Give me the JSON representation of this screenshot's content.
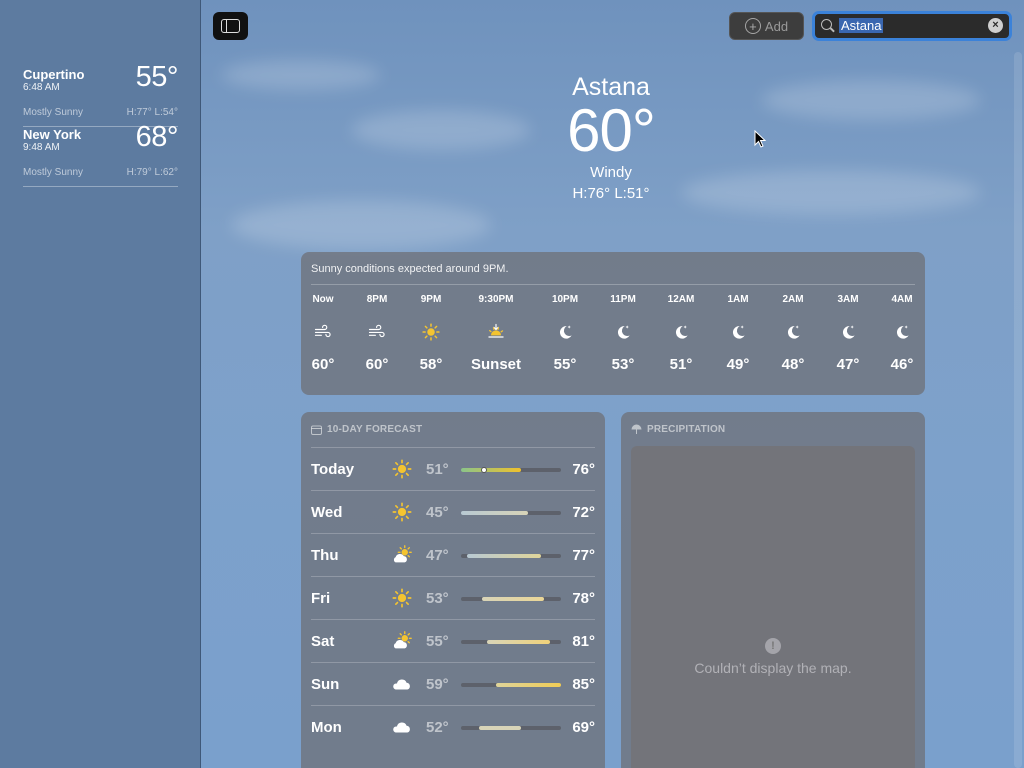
{
  "sidebar": {
    "cities": [
      {
        "name": "Cupertino",
        "time": "6:48 AM",
        "temp": "55°",
        "condition": "Mostly Sunny",
        "hilo": "H:77°  L:54°"
      },
      {
        "name": "New York",
        "time": "9:48 AM",
        "temp": "68°",
        "condition": "Mostly Sunny",
        "hilo": "H:79°  L:62°"
      }
    ]
  },
  "toolbar": {
    "add_label": "Add",
    "search_value": "Astana"
  },
  "current": {
    "city": "Astana",
    "temp": "60°",
    "condition": "Windy",
    "hilo": "H:76°  L:51°"
  },
  "hourly": {
    "summary": "Sunny conditions expected around 9PM.",
    "hours": [
      {
        "label": "Now",
        "icon": "wind-icon",
        "temp": "60°"
      },
      {
        "label": "8PM",
        "icon": "wind-icon",
        "temp": "60°"
      },
      {
        "label": "9PM",
        "icon": "sun-icon",
        "temp": "58°"
      },
      {
        "label": "9:30PM",
        "icon": "sunset-icon",
        "temp": "Sunset"
      },
      {
        "label": "10PM",
        "icon": "moon-stars-icon",
        "temp": "55°"
      },
      {
        "label": "11PM",
        "icon": "moon-stars-icon",
        "temp": "53°"
      },
      {
        "label": "12AM",
        "icon": "moon-stars-icon",
        "temp": "51°"
      },
      {
        "label": "1AM",
        "icon": "moon-stars-icon",
        "temp": "49°"
      },
      {
        "label": "2AM",
        "icon": "moon-stars-icon",
        "temp": "48°"
      },
      {
        "label": "3AM",
        "icon": "moon-stars-icon",
        "temp": "47°"
      },
      {
        "label": "4AM",
        "icon": "moon-stars-icon",
        "temp": "46°"
      }
    ]
  },
  "forecast": {
    "header": "10-DAY FORECAST",
    "days": [
      {
        "day": "Today",
        "icon": "sun-icon",
        "lo": "51°",
        "hi": "76°",
        "range_start": 0.0,
        "range_end": 0.6,
        "current_marker": 0.23,
        "colors": [
          "#8bc48a",
          "#f0c12c"
        ]
      },
      {
        "day": "Wed",
        "icon": "sun-icon",
        "lo": "45°",
        "hi": "72°",
        "range_start": 0.0,
        "range_end": 0.67,
        "colors": [
          "#b8c9d3",
          "#d8d4b8"
        ]
      },
      {
        "day": "Thu",
        "icon": "partly-cloudy-icon",
        "lo": "47°",
        "hi": "77°",
        "range_start": 0.06,
        "range_end": 0.8,
        "colors": [
          "#b8c9d3",
          "#e0d59a"
        ]
      },
      {
        "day": "Fri",
        "icon": "sun-icon",
        "lo": "53°",
        "hi": "78°",
        "range_start": 0.21,
        "range_end": 0.83,
        "colors": [
          "#d8d4b8",
          "#ead697"
        ]
      },
      {
        "day": "Sat",
        "icon": "partly-cloudy-icon",
        "lo": "55°",
        "hi": "81°",
        "range_start": 0.26,
        "range_end": 0.89,
        "colors": [
          "#d8d4b8",
          "#f0d27a"
        ]
      },
      {
        "day": "Sun",
        "icon": "cloud-icon",
        "lo": "59°",
        "hi": "85°",
        "range_start": 0.35,
        "range_end": 1.0,
        "colors": [
          "#dfd49a",
          "#f0cc55"
        ]
      },
      {
        "day": "Mon",
        "icon": "cloud-icon",
        "lo": "52°",
        "hi": "69°",
        "range_start": 0.18,
        "range_end": 0.6,
        "colors": [
          "#d8d4b8",
          "#d8d4b8"
        ]
      }
    ]
  },
  "precipitation": {
    "header": "PRECIPITATION",
    "message": "Couldn’t display the map."
  },
  "colors": {
    "sidebar_bg": "#5d7ba0",
    "search_focus": "#3b82d9",
    "sun": "#f4c430"
  }
}
